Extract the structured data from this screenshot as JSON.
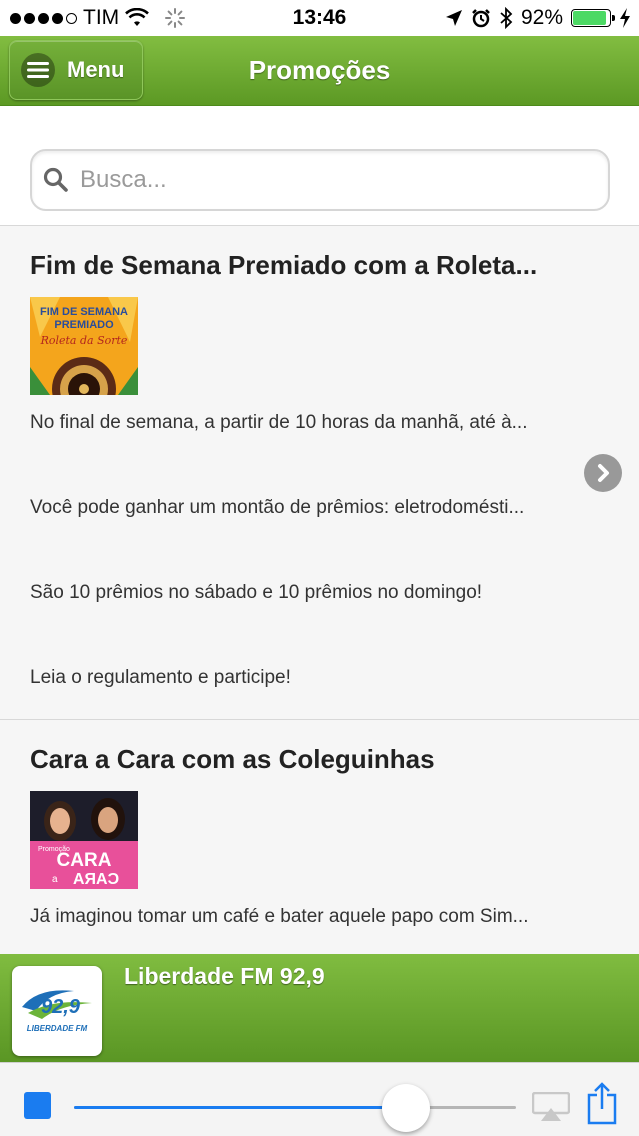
{
  "status_bar": {
    "carrier": "TIM",
    "time": "13:46",
    "battery_percent": "92%",
    "battery_level": 0.92,
    "signal_bars": 4,
    "icons": [
      "wifi-icon",
      "activity-spinner-icon",
      "location-arrow-icon",
      "alarm-clock-icon",
      "bluetooth-icon",
      "battery-icon",
      "charging-bolt-icon"
    ]
  },
  "header": {
    "menu_label": "Menu",
    "title": "Promoções",
    "colors": {
      "bar": "#6dab30",
      "text": "#ffffff"
    }
  },
  "search": {
    "placeholder": "Busca..."
  },
  "promotions": [
    {
      "title": "Fim de Semana Premiado com a Roleta...",
      "image": {
        "line1": "FIM DE SEMANA",
        "line2": "PREMIADO",
        "script": "Roleta da Sorte"
      },
      "paragraphs": [
        "No final de semana, a partir de 10 horas da manhã, até à...",
        "Você pode ganhar um montão de prêmios: eletrodomésti...",
        "São 10 prêmios no sábado e 10 prêmios no domingo!",
        "Leia o regulamento e participe!"
      ]
    },
    {
      "title": "Cara a Cara com as Coleguinhas",
      "image": {
        "small": "Promoção",
        "word1": "CARA",
        "connector": "a",
        "word2": "CARA"
      },
      "paragraphs": [
        "Já imaginou tomar um café e bater aquele papo com Sim..."
      ]
    }
  ],
  "player": {
    "station": "Liberdade FM 92,9",
    "logo_number": "92,9",
    "logo_text": "LIBERDADE FM",
    "volume_level": 0.75
  },
  "colors": {
    "accent_blue": "#1a7cf0",
    "green": "#6dab30"
  }
}
